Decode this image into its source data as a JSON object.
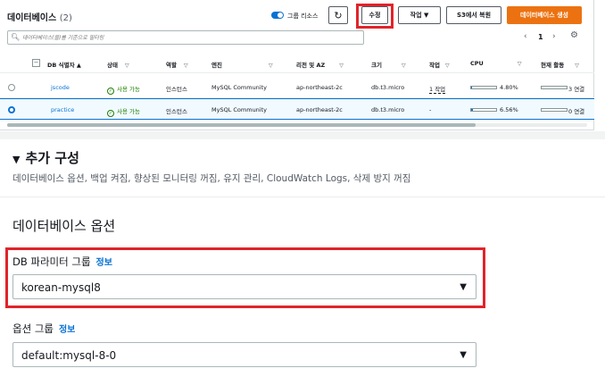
{
  "header": {
    "title": "데이터베이스",
    "count": "(2)",
    "group_resources_label": "그룹 리소스",
    "refresh_icon": "↻",
    "modify_label": "수정",
    "actions_label": "작업 ▼",
    "restore_s3_label": "S3에서 복원",
    "create_label": "데이터베이스 생성"
  },
  "search": {
    "placeholder": "데이터베이스(을)를 기준으로 필터링",
    "icon": "search-icon"
  },
  "pagination": {
    "prev": "‹",
    "page": "1",
    "next": "›",
    "settings": "⚙"
  },
  "table": {
    "columns": [
      "DB 식별자 ▲",
      "상태",
      "역할",
      "엔진",
      "리전 및 AZ",
      "크기",
      "작업",
      "CPU",
      "현재 활동"
    ],
    "rows": [
      {
        "id": "jscode",
        "status": "사용 가능",
        "role": "인스턴스",
        "engine": "MySQL Community",
        "region": "ap-northeast-2c",
        "size": "db.t3.micro",
        "actions": "1 작업",
        "cpu": "4.80%",
        "cpu_fraction": 0.048,
        "activity": "3 연결",
        "selected": false
      },
      {
        "id": "practice",
        "status": "사용 가능",
        "role": "인스턴스",
        "engine": "MySQL Community",
        "region": "ap-northeast-2c",
        "size": "db.t3.micro",
        "actions": "-",
        "cpu": "6.56%",
        "cpu_fraction": 0.0656,
        "activity": "0 연결",
        "selected": true
      }
    ]
  },
  "additional_config": {
    "title": "추가 구성",
    "description": "데이터베이스 옵션, 백업 켜짐, 향상된 모니터링 꺼짐, 유지 관리, CloudWatch Logs, 삭제 방지 꺼짐"
  },
  "db_options": {
    "heading": "데이터베이스 옵션",
    "param_group": {
      "label": "DB 파라미터 그룹",
      "info": "정보",
      "value": "korean-mysql8"
    },
    "option_group": {
      "label": "옵션 그룹",
      "info": "정보",
      "value": "default:mysql-8-0"
    }
  },
  "colors": {
    "accent": "#0972d3",
    "primary_button": "#ec7211",
    "highlight": "#e1232a",
    "success": "#1d8102"
  }
}
